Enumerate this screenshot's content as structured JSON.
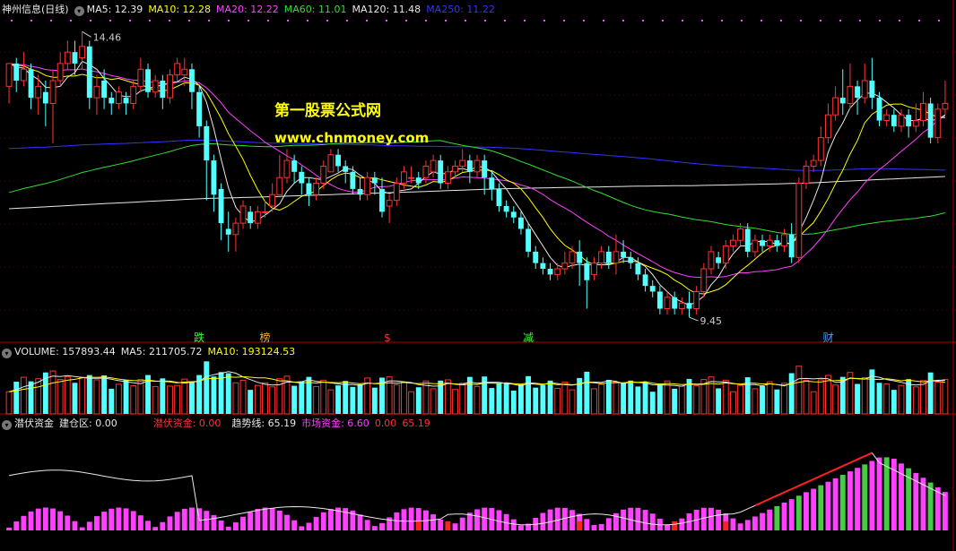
{
  "header": {
    "title": "神州信息(日线)",
    "ma": [
      {
        "label": "MA5: 12.39",
        "color": "#e8e8e8"
      },
      {
        "label": "MA10: 12.28",
        "color": "#ffff00"
      },
      {
        "label": "MA20: 12.22",
        "color": "#ff40ff"
      },
      {
        "label": "MA60: 11.01",
        "color": "#33dd33"
      },
      {
        "label": "MA120: 11.48",
        "color": "#e8e8e8"
      },
      {
        "label": "MA250: 11.22",
        "color": "#3333ff"
      }
    ]
  },
  "watermark": {
    "title": "第一股票公式网",
    "url": "www.chnmoney.com"
  },
  "chart_data": [
    {
      "type": "candlestick",
      "panel": "price",
      "ylim": [
        9.2,
        14.7
      ],
      "high_label": "14.46",
      "low_label": "9.45",
      "colors": {
        "up": "#ff3232",
        "down": "#54ffff",
        "ma5": "#e8e8e8",
        "ma10": "#ffff00",
        "ma20": "#ff40ff",
        "ma60": "#33dd33",
        "ma120": "#e8e8e8",
        "ma250": "#3333ff"
      },
      "candles": [
        [
          13.5,
          13.9,
          13.5,
          13.2
        ],
        [
          13.9,
          13.6,
          14.0,
          13.4
        ],
        [
          13.6,
          13.8,
          14.1,
          13.5
        ],
        [
          13.8,
          13.3,
          13.9,
          13.1
        ],
        [
          13.3,
          13.5,
          13.7,
          13.0
        ],
        [
          13.4,
          13.2,
          13.6,
          12.8
        ],
        [
          13.2,
          13.6,
          13.8,
          12.5
        ],
        [
          13.6,
          13.9,
          14.1,
          13.5
        ],
        [
          13.9,
          14.1,
          14.3,
          13.8
        ],
        [
          14.1,
          13.9,
          14.3,
          13.7
        ],
        [
          14.0,
          14.2,
          14.46,
          13.8
        ],
        [
          14.2,
          13.3,
          14.3,
          13.1
        ],
        [
          13.3,
          13.5,
          13.7,
          13.0
        ],
        [
          13.6,
          13.3,
          13.8,
          13.1
        ],
        [
          13.3,
          13.2,
          13.4,
          13.0
        ],
        [
          13.2,
          13.4,
          13.5,
          13.1
        ],
        [
          13.3,
          13.2,
          13.4,
          13.0
        ],
        [
          13.2,
          13.5,
          13.6,
          13.1
        ],
        [
          13.5,
          13.8,
          14.0,
          13.4
        ],
        [
          13.8,
          13.4,
          13.9,
          13.3
        ],
        [
          13.4,
          13.6,
          13.7,
          13.3
        ],
        [
          13.6,
          13.3,
          13.7,
          13.1
        ],
        [
          13.3,
          13.7,
          13.8,
          13.2
        ],
        [
          13.7,
          13.9,
          14.0,
          13.6
        ],
        [
          13.7,
          13.8,
          14.0,
          13.5
        ],
        [
          13.8,
          13.4,
          13.9,
          13.1
        ],
        [
          13.4,
          12.8,
          13.5,
          12.6
        ],
        [
          12.8,
          12.2,
          12.9,
          11.5
        ],
        [
          12.2,
          11.6,
          12.3,
          11.3
        ],
        [
          11.7,
          11.1,
          11.8,
          10.8
        ],
        [
          11.0,
          10.9,
          11.3,
          10.6
        ],
        [
          10.9,
          11.1,
          11.2,
          10.6
        ],
        [
          11.1,
          11.4,
          11.5,
          11.0
        ],
        [
          11.3,
          11.1,
          11.4,
          11.0
        ],
        [
          11.1,
          11.3,
          11.4,
          11.0
        ],
        [
          11.3,
          11.3,
          11.5,
          11.2
        ],
        [
          11.4,
          11.6,
          11.8,
          11.3
        ],
        [
          11.6,
          11.9,
          12.3,
          11.6
        ],
        [
          11.9,
          12.2,
          12.4,
          11.8
        ],
        [
          12.2,
          12.0,
          12.3,
          11.8
        ],
        [
          12.0,
          11.8,
          12.1,
          11.6
        ],
        [
          11.8,
          11.6,
          11.9,
          11.4
        ],
        [
          11.6,
          11.8,
          11.9,
          11.5
        ],
        [
          11.8,
          12.1,
          12.2,
          11.7
        ],
        [
          12.0,
          12.3,
          12.4,
          12.0
        ],
        [
          12.3,
          12.1,
          12.4,
          12.0
        ],
        [
          12.1,
          12.0,
          12.2,
          11.8
        ],
        [
          12.0,
          11.7,
          12.1,
          11.6
        ],
        [
          11.7,
          11.6,
          11.9,
          11.5
        ],
        [
          11.6,
          11.9,
          12.0,
          11.5
        ],
        [
          11.9,
          11.8,
          12.0,
          11.6
        ],
        [
          11.7,
          11.3,
          11.9,
          11.2
        ],
        [
          11.4,
          11.5,
          11.6,
          11.1
        ],
        [
          11.5,
          11.8,
          11.9,
          11.4
        ],
        [
          11.8,
          12.0,
          12.1,
          11.7
        ],
        [
          11.9,
          11.9,
          12.1,
          11.8
        ],
        [
          11.9,
          11.8,
          12.0,
          11.7
        ],
        [
          11.9,
          12.1,
          12.2,
          11.8
        ],
        [
          12.0,
          12.2,
          12.3,
          11.9
        ],
        [
          12.2,
          11.8,
          12.3,
          11.7
        ],
        [
          11.8,
          12.0,
          12.1,
          11.7
        ],
        [
          12.0,
          12.1,
          12.2,
          11.9
        ],
        [
          12.1,
          12.2,
          12.4,
          12.0
        ],
        [
          12.2,
          12.0,
          12.3,
          11.8
        ],
        [
          12.0,
          12.2,
          12.3,
          11.9
        ],
        [
          12.2,
          11.9,
          12.3,
          11.6
        ],
        [
          11.9,
          11.7,
          12.0,
          11.5
        ],
        [
          11.7,
          11.4,
          11.8,
          11.3
        ],
        [
          11.4,
          11.3,
          11.5,
          11.2
        ],
        [
          11.3,
          11.2,
          11.4,
          11.1
        ],
        [
          11.2,
          11.0,
          11.3,
          10.9
        ],
        [
          11.0,
          10.6,
          11.1,
          10.5
        ],
        [
          10.6,
          10.4,
          10.7,
          10.3
        ],
        [
          10.4,
          10.3,
          10.5,
          10.2
        ],
        [
          10.3,
          10.2,
          10.4,
          10.1
        ],
        [
          10.2,
          10.3,
          10.4,
          10.1
        ],
        [
          10.3,
          10.4,
          10.6,
          10.2
        ],
        [
          10.4,
          10.6,
          10.7,
          10.3
        ],
        [
          10.6,
          10.4,
          10.8,
          10.0
        ],
        [
          10.4,
          10.1,
          10.5,
          9.6
        ],
        [
          10.2,
          10.4,
          10.5,
          10.1
        ],
        [
          10.4,
          10.6,
          10.7,
          10.3
        ],
        [
          10.6,
          10.4,
          10.7,
          10.3
        ],
        [
          10.4,
          10.6,
          10.9,
          10.2
        ],
        [
          10.6,
          10.5,
          10.8,
          10.4
        ],
        [
          10.5,
          10.4,
          10.6,
          10.3
        ],
        [
          10.4,
          10.2,
          10.5,
          10.1
        ],
        [
          10.2,
          10.0,
          10.3,
          9.9
        ],
        [
          10.0,
          9.9,
          10.1,
          9.8
        ],
        [
          9.9,
          9.6,
          10.0,
          9.5
        ],
        [
          9.6,
          9.8,
          9.9,
          9.5
        ],
        [
          9.8,
          9.6,
          9.9,
          9.5
        ],
        [
          9.6,
          9.7,
          9.8,
          9.5
        ],
        [
          9.7,
          9.6,
          9.9,
          9.45
        ],
        [
          9.6,
          9.9,
          10.0,
          9.5
        ],
        [
          9.9,
          10.3,
          10.4,
          9.8
        ],
        [
          10.3,
          10.6,
          10.7,
          10.2
        ],
        [
          10.5,
          10.4,
          10.6,
          10.3
        ],
        [
          10.4,
          10.7,
          10.8,
          10.3
        ],
        [
          10.7,
          10.8,
          10.9,
          10.6
        ],
        [
          10.8,
          11.0,
          11.1,
          10.7
        ],
        [
          11.0,
          10.6,
          11.1,
          10.5
        ],
        [
          10.6,
          10.8,
          10.9,
          10.5
        ],
        [
          10.8,
          10.7,
          10.9,
          10.6
        ],
        [
          10.7,
          10.8,
          10.9,
          10.6
        ],
        [
          10.8,
          10.7,
          10.9,
          10.6
        ],
        [
          10.7,
          10.9,
          11.0,
          10.6
        ],
        [
          10.9,
          10.5,
          11.1,
          10.4
        ],
        [
          10.5,
          11.8,
          11.9,
          10.4
        ],
        [
          11.8,
          12.1,
          12.2,
          11.7
        ],
        [
          12.1,
          12.2,
          12.3,
          12.0
        ],
        [
          12.2,
          12.6,
          12.8,
          12.1
        ],
        [
          12.6,
          13.0,
          13.2,
          12.5
        ],
        [
          13.0,
          13.3,
          13.5,
          12.9
        ],
        [
          13.3,
          13.2,
          13.8,
          13.0
        ],
        [
          13.2,
          13.5,
          13.9,
          13.1
        ],
        [
          13.5,
          13.3,
          13.6,
          13.0
        ],
        [
          13.3,
          13.6,
          13.9,
          13.2
        ],
        [
          13.6,
          13.3,
          14.0,
          13.1
        ],
        [
          13.3,
          12.9,
          13.4,
          12.8
        ],
        [
          12.9,
          13.0,
          13.1,
          12.8
        ],
        [
          13.0,
          12.8,
          13.1,
          12.7
        ],
        [
          12.8,
          13.0,
          13.1,
          12.7
        ],
        [
          13.0,
          12.8,
          13.1,
          12.6
        ],
        [
          12.8,
          12.9,
          13.2,
          12.7
        ],
        [
          12.9,
          13.2,
          13.4,
          12.8
        ],
        [
          13.2,
          12.6,
          13.3,
          12.5
        ],
        [
          12.6,
          13.1,
          13.2,
          12.5
        ],
        [
          13.1,
          13.2,
          13.6,
          13.0
        ]
      ],
      "markers": [
        {
          "index": 26,
          "text": "跌",
          "color": "#33ff33"
        },
        {
          "index": 35,
          "text": "榜",
          "color": "#ffaa33"
        },
        {
          "index": 52,
          "text": "$",
          "color": "#ff3333"
        },
        {
          "index": 71,
          "text": "减",
          "color": "#33ff33"
        },
        {
          "index": 112,
          "text": "财",
          "color": "#5599ff"
        }
      ]
    },
    {
      "type": "bar",
      "panel": "volume",
      "header": [
        {
          "label": "VOLUME: 157893.44",
          "color": "#e8e8e8"
        },
        {
          "label": "MA5: 211705.72",
          "color": "#e8e8e8"
        },
        {
          "label": "MA10: 193124.53",
          "color": "#ffff00"
        }
      ],
      "ylim": [
        0,
        300000
      ]
    },
    {
      "type": "bar",
      "panel": "indicator",
      "header": [
        {
          "label": "潜伏资金",
          "color": "#e8e8e8"
        },
        {
          "label": "建仓区: 0.00",
          "color": "#e8e8e8"
        },
        {
          "label": "潜伏资金: 0.00",
          "color": "#ff3333"
        },
        {
          "label": "趋势线: 65.19",
          "color": "#e8e8e8"
        },
        {
          "label": "市场资金: 6.60",
          "color": "#ff40ff"
        },
        {
          "label": "0.00",
          "color": "#ff3333"
        },
        {
          "label": "65.19",
          "color": "#ff3333"
        }
      ],
      "ylim": [
        0,
        100
      ]
    }
  ]
}
